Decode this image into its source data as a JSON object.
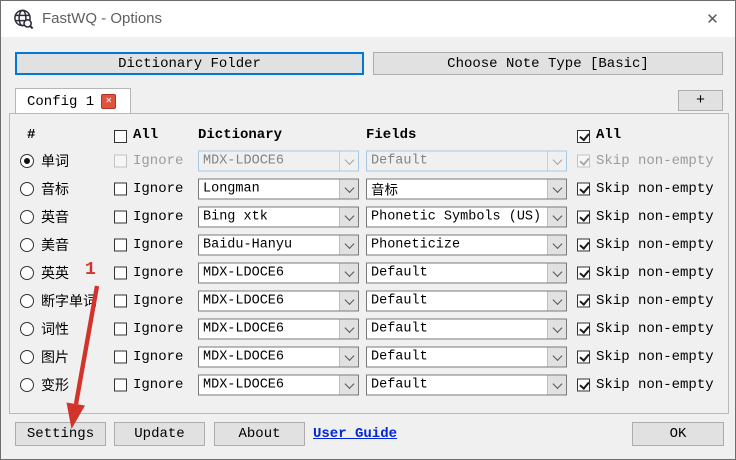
{
  "window": {
    "title": "FastWQ - Options",
    "close_glyph": "✕"
  },
  "toolbar": {
    "dictionary_folder_label": "Dictionary Folder",
    "choose_note_type_label": "Choose Note Type [Basic]"
  },
  "tabs": {
    "active_tab": "Config 1",
    "tab_close_glyph": "✕",
    "add_tab_label": "+"
  },
  "table": {
    "headers": {
      "hash": "#",
      "all_left": "All",
      "dictionary": "Dictionary",
      "fields": "Fields",
      "all_right": "All"
    },
    "ignore_label": "Ignore",
    "skip_label": "Skip non-empty",
    "rows": [
      {
        "label": "单词",
        "selected": true,
        "disabled": true,
        "ignore_checked": false,
        "dictionary": "MDX-LDOCE6",
        "field": "Default",
        "skip_checked": true
      },
      {
        "label": "音标",
        "selected": false,
        "disabled": false,
        "ignore_checked": false,
        "dictionary": "Longman",
        "field": "音标",
        "skip_checked": true
      },
      {
        "label": "英音",
        "selected": false,
        "disabled": false,
        "ignore_checked": false,
        "dictionary": "Bing xtk",
        "field": "Phonetic Symbols (US)",
        "skip_checked": true
      },
      {
        "label": "美音",
        "selected": false,
        "disabled": false,
        "ignore_checked": false,
        "dictionary": "Baidu-Hanyu",
        "field": "Phoneticize",
        "skip_checked": true
      },
      {
        "label": "英英",
        "selected": false,
        "disabled": false,
        "ignore_checked": false,
        "dictionary": "MDX-LDOCE6",
        "field": "Default",
        "skip_checked": true,
        "annotation": "1"
      },
      {
        "label": "断字单词",
        "selected": false,
        "disabled": false,
        "ignore_checked": false,
        "dictionary": "MDX-LDOCE6",
        "field": "Default",
        "skip_checked": true
      },
      {
        "label": "词性",
        "selected": false,
        "disabled": false,
        "ignore_checked": false,
        "dictionary": "MDX-LDOCE6",
        "field": "Default",
        "skip_checked": true
      },
      {
        "label": "图片",
        "selected": false,
        "disabled": false,
        "ignore_checked": false,
        "dictionary": "MDX-LDOCE6",
        "field": "Default",
        "skip_checked": true
      },
      {
        "label": "变形",
        "selected": false,
        "disabled": false,
        "ignore_checked": false,
        "dictionary": "MDX-LDOCE6",
        "field": "Default",
        "skip_checked": true
      }
    ]
  },
  "footer": {
    "settings_label": "Settings",
    "update_label": "Update",
    "about_label": "About",
    "user_guide_label": "User Guide",
    "ok_label": "OK"
  },
  "colors": {
    "focus_accent": "#0078d7",
    "annotation_red": "#d2342c",
    "link_blue": "#0026d8",
    "tab_close_red": "#e0543e"
  }
}
